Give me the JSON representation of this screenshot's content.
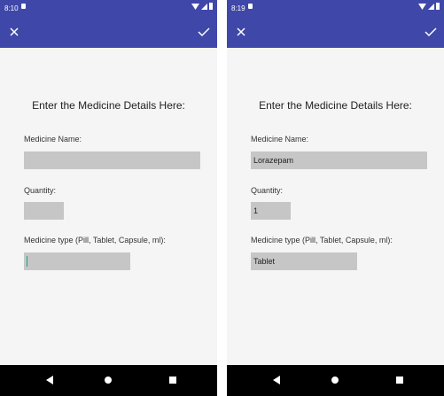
{
  "screens": [
    {
      "status_time": "8:10",
      "heading": "Enter the Medicine Details Here:",
      "name_label": "Medicine Name:",
      "name_value": "",
      "qty_label": "Quantity:",
      "qty_value": "",
      "type_label": "Medicine type (Pill, Tablet, Capsule, ml):",
      "type_value": ""
    },
    {
      "status_time": "8:19",
      "heading": "Enter the Medicine Details Here:",
      "name_label": "Medicine Name:",
      "name_value": "Lorazepam",
      "qty_label": "Quantity:",
      "qty_value": "1",
      "type_label": "Medicine type (Pill, Tablet, Capsule, ml):",
      "type_value": "Tablet"
    }
  ],
  "icons": {
    "close": "close-icon",
    "confirm": "check-icon",
    "back": "nav-back-icon",
    "home": "nav-home-icon",
    "recents": "nav-recents-icon"
  },
  "colors": {
    "app_bar": "#3f48a8",
    "field": "#c6c6c6",
    "cursor": "#18a394",
    "nav_bar": "#000000"
  }
}
